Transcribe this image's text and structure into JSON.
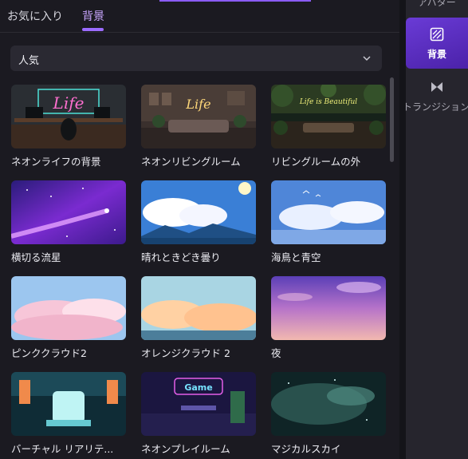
{
  "tabs": [
    {
      "label": "お気に入り"
    },
    {
      "label": "背景"
    }
  ],
  "filter": {
    "selected": "人気"
  },
  "cards": [
    {
      "caption": "ネオンライフの背景",
      "neon_text": "Life"
    },
    {
      "caption": "ネオンリビングルーム",
      "neon_text": "Life"
    },
    {
      "caption": "リビングルームの外",
      "neon_text": "Life is Beautiful"
    },
    {
      "caption": "横切る流星"
    },
    {
      "caption": "晴れときどき曇り"
    },
    {
      "caption": "海鳥と青空"
    },
    {
      "caption": "ピンククラウド2"
    },
    {
      "caption": "オレンジクラウド 2"
    },
    {
      "caption": "夜"
    },
    {
      "caption": "バーチャル リアリテ..."
    },
    {
      "caption": "ネオンプレイルーム",
      "neon_text": "Game"
    },
    {
      "caption": "マジカルスカイ"
    }
  ],
  "right_toolbar": {
    "avatar_label": "アバター",
    "background_label": "背景",
    "transition_label": "トランジション"
  },
  "colors": {
    "accent": "#8b5cf6",
    "panel_bg": "#1b1a21",
    "active_tab": "#c9a6ff"
  }
}
